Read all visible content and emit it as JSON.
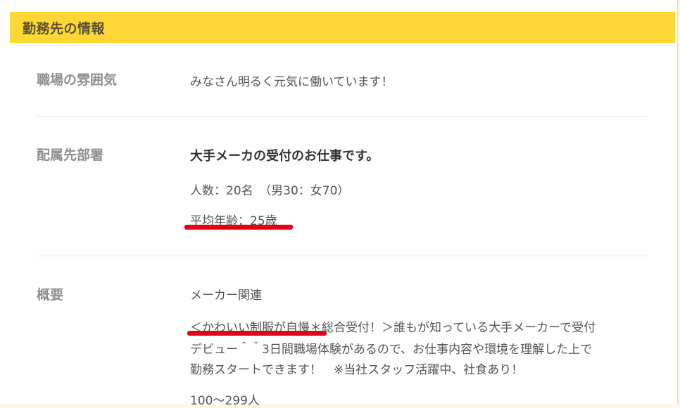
{
  "header": {
    "title": "勤務先の情報"
  },
  "rows": [
    {
      "label": "職場の雰囲気",
      "lines": [
        "みなさん明るく元気に働いています！"
      ]
    },
    {
      "label": "配属先部署",
      "lines": [
        "大手メーカの受付のお仕事です。",
        "人数：20名　（男30：女70）",
        "平均年齢：25歳"
      ]
    },
    {
      "label": "概要",
      "lines": [
        "メーカー関連",
        "＜かわいい制服が自慢＊総合受付！＞誰もが知っている大手メーカーで受付",
        "デビュー＾＾3日間職場体験があるので、お仕事内容や環境を理解した上で",
        "勤務スタートできます！　※当社スタッフ活躍中、社食あり！",
        "100〜299人"
      ]
    }
  ],
  "colors": {
    "header_bg": "#ffd835",
    "underline": "#e0001b"
  }
}
